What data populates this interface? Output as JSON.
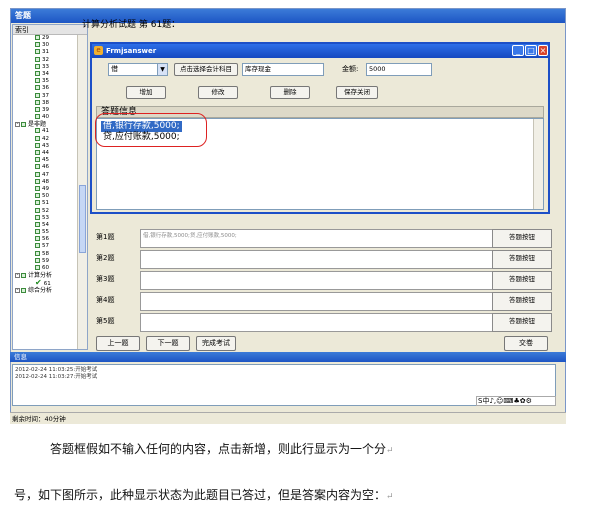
{
  "app": {
    "title": "答题",
    "tree_header": "索引",
    "tree_items": [
      {
        "kind": "leaf",
        "label": "29"
      },
      {
        "kind": "leaf",
        "label": "30"
      },
      {
        "kind": "leaf",
        "label": "31"
      },
      {
        "kind": "leaf",
        "label": "32"
      },
      {
        "kind": "leaf",
        "label": "33"
      },
      {
        "kind": "leaf",
        "label": "34"
      },
      {
        "kind": "leaf",
        "label": "35"
      },
      {
        "kind": "leaf",
        "label": "36"
      },
      {
        "kind": "leaf",
        "label": "37"
      },
      {
        "kind": "leaf",
        "label": "38"
      },
      {
        "kind": "leaf",
        "label": "39"
      },
      {
        "kind": "leaf",
        "label": "40"
      },
      {
        "kind": "group",
        "label": "是非题"
      },
      {
        "kind": "leaf",
        "label": "41"
      },
      {
        "kind": "leaf",
        "label": "42"
      },
      {
        "kind": "leaf",
        "label": "43"
      },
      {
        "kind": "leaf",
        "label": "44"
      },
      {
        "kind": "leaf",
        "label": "45"
      },
      {
        "kind": "leaf",
        "label": "46"
      },
      {
        "kind": "leaf",
        "label": "47"
      },
      {
        "kind": "leaf",
        "label": "48"
      },
      {
        "kind": "leaf",
        "label": "49"
      },
      {
        "kind": "leaf",
        "label": "50"
      },
      {
        "kind": "leaf",
        "label": "51"
      },
      {
        "kind": "leaf",
        "label": "52"
      },
      {
        "kind": "leaf",
        "label": "53"
      },
      {
        "kind": "leaf",
        "label": "54"
      },
      {
        "kind": "leaf",
        "label": "55"
      },
      {
        "kind": "leaf",
        "label": "56"
      },
      {
        "kind": "leaf",
        "label": "57"
      },
      {
        "kind": "leaf",
        "label": "58"
      },
      {
        "kind": "leaf",
        "label": "59"
      },
      {
        "kind": "leaf",
        "label": "60"
      },
      {
        "kind": "group",
        "label": "计算分析"
      },
      {
        "kind": "checked",
        "label": "61"
      },
      {
        "kind": "group",
        "label": "综合分析"
      }
    ],
    "panel_title": "计算分析试题    第 61题：",
    "grid_rows": [
      {
        "label": "第1题",
        "value": "借,银行存款,5000;贷,应付账款,5000;",
        "button": "答题按钮"
      },
      {
        "label": "第2题",
        "value": "",
        "button": "答题按钮"
      },
      {
        "label": "第3题",
        "value": "",
        "button": "答题按钮"
      },
      {
        "label": "第4题",
        "value": "",
        "button": "答题按钮"
      },
      {
        "label": "第5题",
        "value": "",
        "button": "答题按钮"
      }
    ],
    "bottom_buttons": {
      "prev": "上一题",
      "next": "下一题",
      "finish": "完成考试",
      "submit": "交卷"
    }
  },
  "dialog": {
    "title": "Frmjsanswer",
    "direction_select": "借",
    "account_button": "点击选择会计科目",
    "account_value": "库存现金",
    "amount_label": "金额:",
    "amount_value": "5000",
    "buttons": {
      "add": "增加",
      "modify": "修改",
      "delete": "删除",
      "save_close": "保存关闭"
    },
    "answer_header": "答题信息",
    "answers": [
      "借,银行存款,5000;",
      "贷,应付账款,5000;"
    ],
    "win_min": "_",
    "win_max": "□",
    "win_close": "×"
  },
  "log": {
    "title": "信息",
    "lines": [
      "2012-02-24 11:03:25:开始考试",
      "2012-02-24 11:03:27:开始考试"
    ],
    "ime": "S中♪,☺⌨♣✿⚙"
  },
  "status_bar": "剩余时间：40分钟",
  "captions": {
    "line1": "答题框假如不输入任何的内容，点击新增，则此行显示为一个分",
    "line2": "号，如下图所示，此种显示状态为此题目已答过，但是答案内容为空：",
    "para_mark": "↵"
  },
  "colors": {
    "titlebar": "#1d55c4",
    "selection": "#316ac5",
    "highlight_oval": "#dd2222",
    "window_bg": "#ece9d8"
  }
}
